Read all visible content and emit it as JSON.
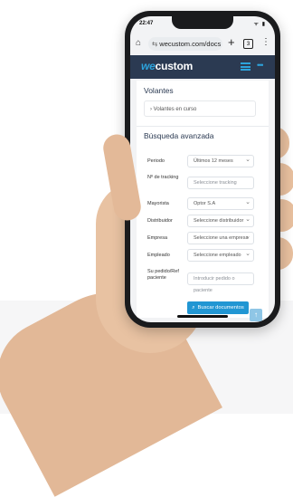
{
  "status": {
    "time": "22:47",
    "icons": "ᯤ ▮"
  },
  "browser": {
    "url": "wecustom.com/docs",
    "tabs_count": "3"
  },
  "app": {
    "logo_we": "we",
    "logo_custom": "custom"
  },
  "volantes": {
    "title": "Volantes",
    "link": "Volantes en curso"
  },
  "advanced_search": {
    "title": "Búsqueda avanzada",
    "fields": [
      {
        "label": "Periodo",
        "value": "Últimos 12 meses",
        "kind": "select"
      },
      {
        "label": "Nº de tracking",
        "value": "Seleccione tracking",
        "kind": "input"
      },
      {
        "label": "Mayorista",
        "value": "Optor S.A",
        "kind": "select"
      },
      {
        "label": "Distribuidor",
        "value": "Seleccione distribuidor",
        "kind": "select"
      },
      {
        "label": "Empresa",
        "value": "Seleccione una empresa",
        "kind": "select"
      },
      {
        "label": "Empleado",
        "value": "Seleccione empleado",
        "kind": "select"
      },
      {
        "label": "Su pedido/Ref paciente",
        "value": "Introducir pedido o paciente",
        "kind": "input"
      }
    ],
    "search_button": "Buscar documentos"
  },
  "colors": {
    "appbar": "#2b3a52",
    "accent": "#2da3dc",
    "button": "#2196d3"
  }
}
